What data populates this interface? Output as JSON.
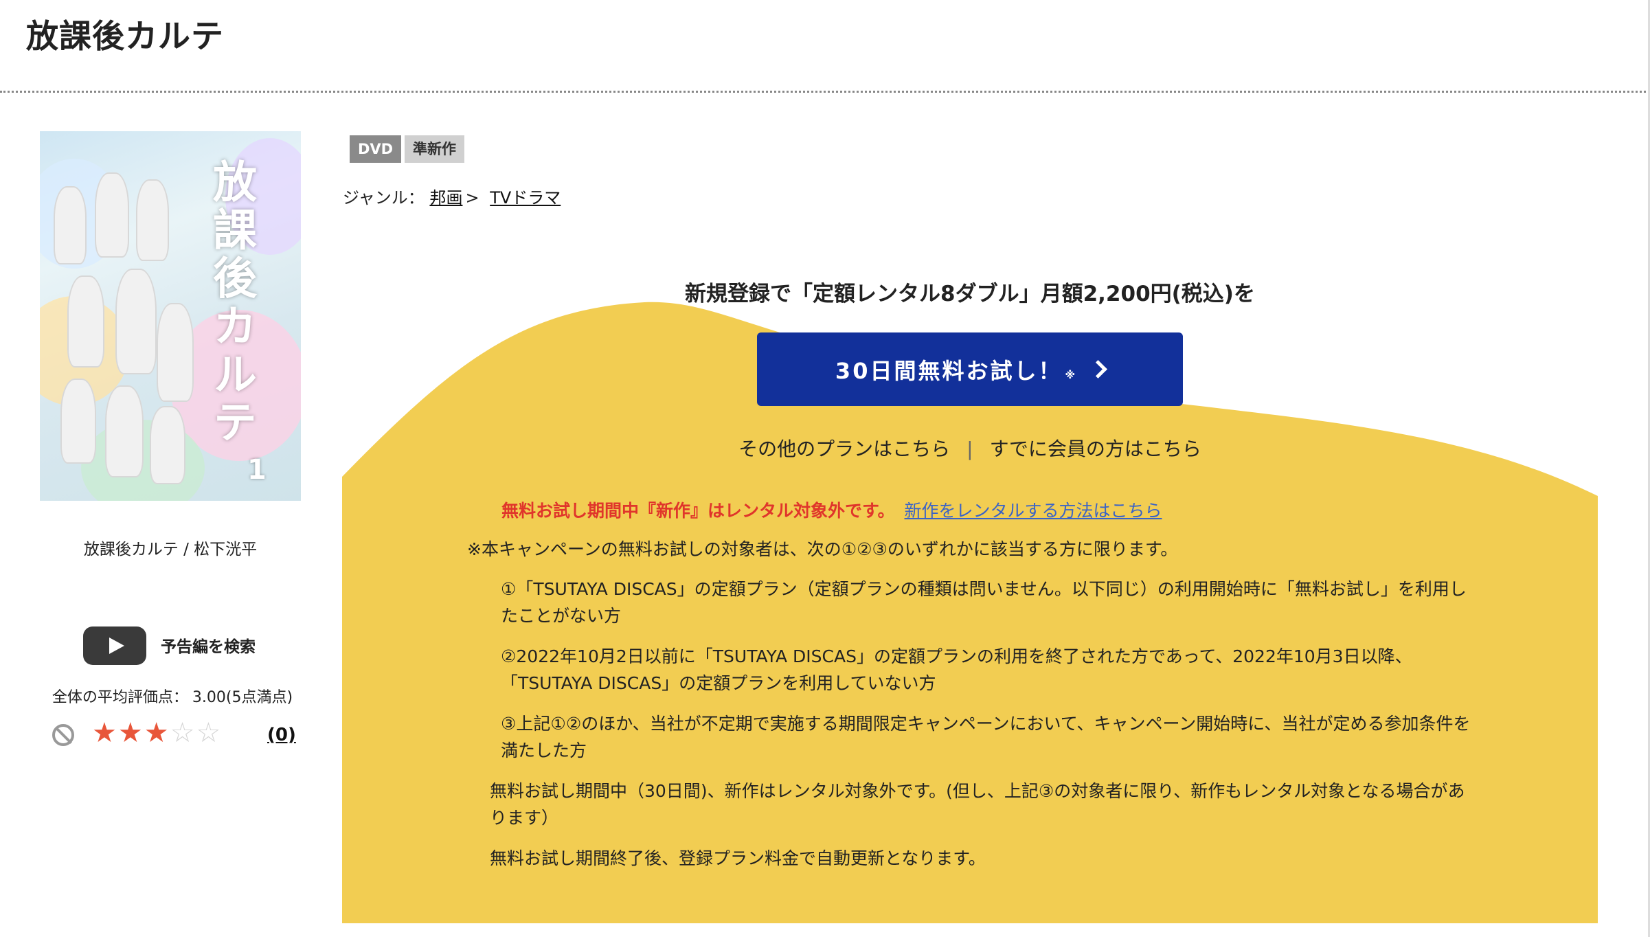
{
  "page": {
    "title": "放課後カルテ"
  },
  "item": {
    "caption": "放課後カルテ / 松下洸平",
    "poster": {
      "title_text": "放課後カルテ",
      "volume": "1"
    },
    "trailer_label": "予告編を検索",
    "rating": {
      "label": "全体の平均評価点：",
      "value": "3.00(5点満点)",
      "stars_filled": 3,
      "stars_total": 5,
      "review_count": "(0)"
    },
    "tags": [
      "DVD",
      "準新作"
    ],
    "genre": {
      "label": "ジャンル：",
      "items": [
        "邦画",
        "TVドラマ"
      ],
      "separator": ">"
    }
  },
  "campaign": {
    "headline": "新規登録で「定額レンタル8ダブル」月額2,200円(税込)を",
    "cta_label": "30日間無料お試し！",
    "cta_mark": "※",
    "other_plans": "その他のプランはこちら",
    "divider": "|",
    "member_link": "すでに会員の方はこちら",
    "warning": "無料お試し期間中『新作』はレンタル対象外です。",
    "warning_link": "新作をレンタルする方法はこちら",
    "note_main": "※本キャンペーンの無料お試しの対象者は、次の①②③のいずれかに該当する方に限ります。",
    "conditions": [
      "①「TSUTAYA DISCAS」の定額プラン（定額プランの種類は問いません。以下同じ）の利用開始時に「無料お試し」を利用したことがない方",
      "②2022年10月2日以前に「TSUTAYA DISCAS」の定額プランの利用を終了された方であって、2022年10月3日以降、「TSUTAYA DISCAS」の定額プランを利用していない方",
      "③上記①②のほか、当社が不定期で実施する期間限定キャンペーンにおいて、キャンペーン開始時に、当社が定める参加条件を満たした方"
    ],
    "notes": [
      "無料お試し期間中（30日間)、新作はレンタル対象外です。(但し、上記③の対象者に限り、新作もレンタル対象となる場合があります）",
      "無料お試し期間終了後、登録プラン料金で自動更新となります。"
    ]
  },
  "colors": {
    "accent_blue": "#12309a",
    "campaign_bg": "#f2cd52",
    "warning_red": "#e0352b",
    "link_blue": "#3a63c7",
    "star_on": "#e8563a"
  }
}
